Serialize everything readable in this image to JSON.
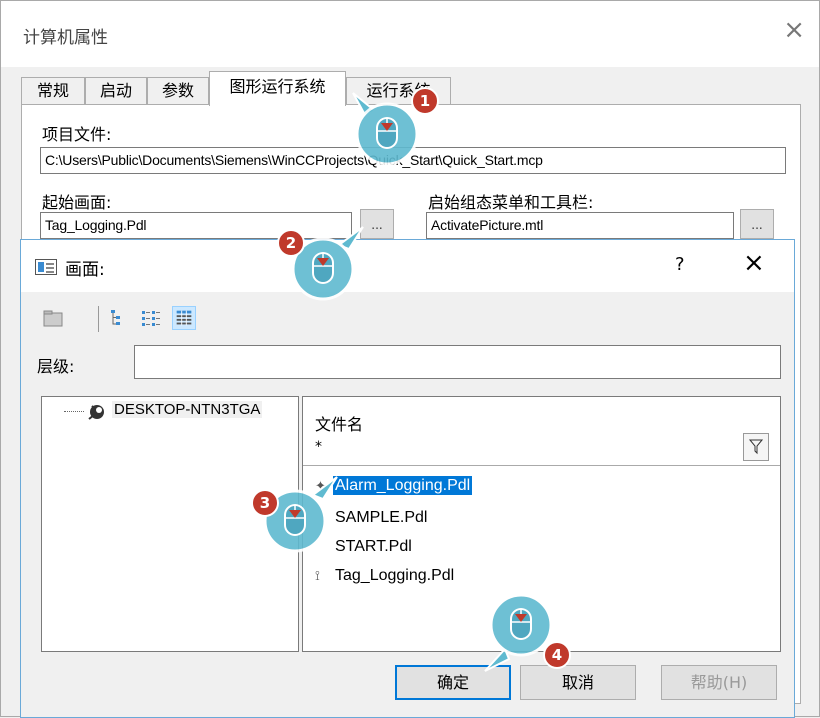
{
  "window": {
    "title": "计算机属性",
    "close_glyph": "×"
  },
  "tabs": [
    {
      "label": "常规"
    },
    {
      "label": "启动"
    },
    {
      "label": "参数"
    },
    {
      "label": "图形运行系统",
      "active": true
    },
    {
      "label": "运行系统"
    }
  ],
  "project_file": {
    "label": "项目文件:",
    "value": "C:\\Users\\Public\\Documents\\Siemens\\WinCCProjects\\Quick_Start\\Quick_Start.mcp"
  },
  "start_picture": {
    "label": "起始画面:",
    "value": "Tag_Logging.Pdl",
    "browse": "..."
  },
  "start_menu": {
    "label": "启始组态菜单和工具栏:",
    "value": "ActivatePicture.mtl",
    "browse": "..."
  },
  "dialog": {
    "title": "画面:",
    "help_glyph": "?",
    "close_glyph": "×",
    "level_label": "层级:",
    "level_value": "",
    "tree_root": "DESKTOP-NTN3TGA",
    "column_header": "文件名",
    "filter_value": "*",
    "files": [
      {
        "name": "Alarm_Logging.Pdl",
        "selected": true
      },
      {
        "name": "SAMPLE.Pdl"
      },
      {
        "name": "START.Pdl"
      },
      {
        "name": "Tag_Logging.Pdl"
      }
    ],
    "buttons": {
      "ok": "确定",
      "cancel": "取消",
      "help": "帮助(H)"
    }
  },
  "steps": [
    "1",
    "2",
    "3",
    "4"
  ],
  "colors": {
    "selection": "#0078d7",
    "badge": "#c0392b",
    "cursor": "#5fbad0"
  }
}
